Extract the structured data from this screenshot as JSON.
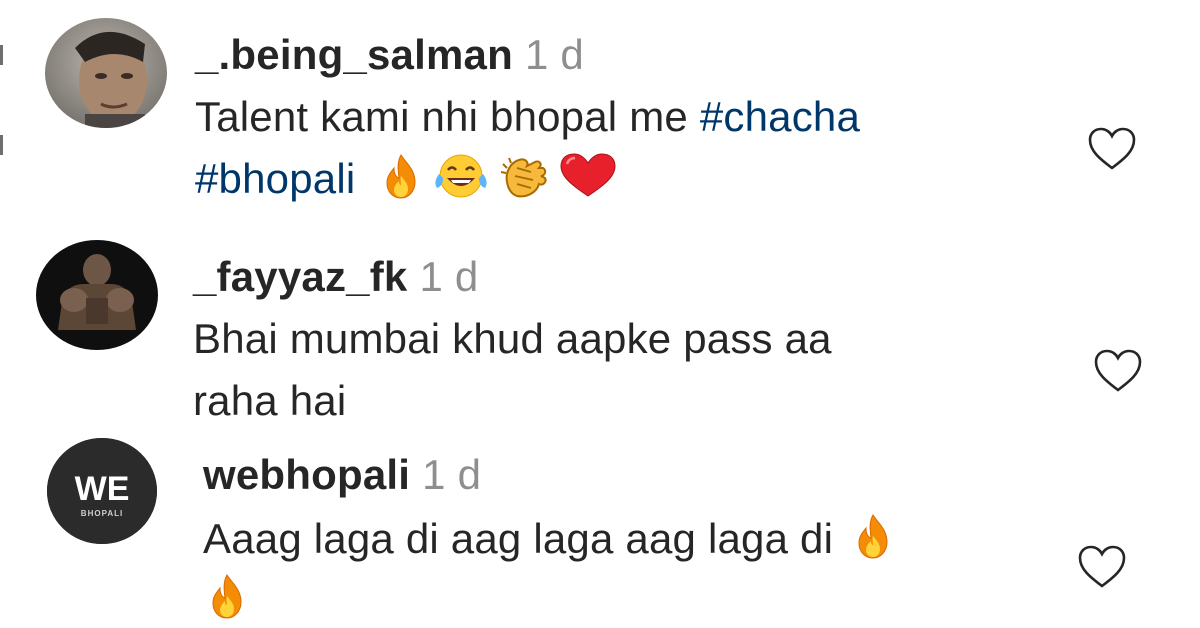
{
  "comments": [
    {
      "username": "_.being_salman",
      "time": "1 d",
      "text_1": "Talent kami nhi bhopal me ",
      "hashtag_1": "#chacha",
      "hashtag_2": "#bhopali",
      "emojis": [
        "fire-emoji",
        "tears-of-joy-emoji",
        "clapping-hands-emoji",
        "red-heart-emoji"
      ],
      "like_icon": "heart-outline-icon"
    },
    {
      "username": "_fayyaz_fk",
      "time": "1 d",
      "text_1": "Bhai mumbai khud aapke pass aa",
      "text_2": "raha hai",
      "like_icon": "heart-outline-icon"
    },
    {
      "username": "webhopali",
      "time": "1 d",
      "text_1": "Aaag laga di aag laga aag laga di",
      "emojis": [
        "fire-emoji",
        "fire-emoji"
      ],
      "avatar_logo_text": "WE",
      "avatar_logo_subtext": "BHOPALI",
      "like_icon": "heart-outline-icon"
    }
  ],
  "colors": {
    "text": "#262626",
    "timestamp": "#8e8e8e",
    "hashtag": "#00376b",
    "heart_outline": "#262626"
  }
}
